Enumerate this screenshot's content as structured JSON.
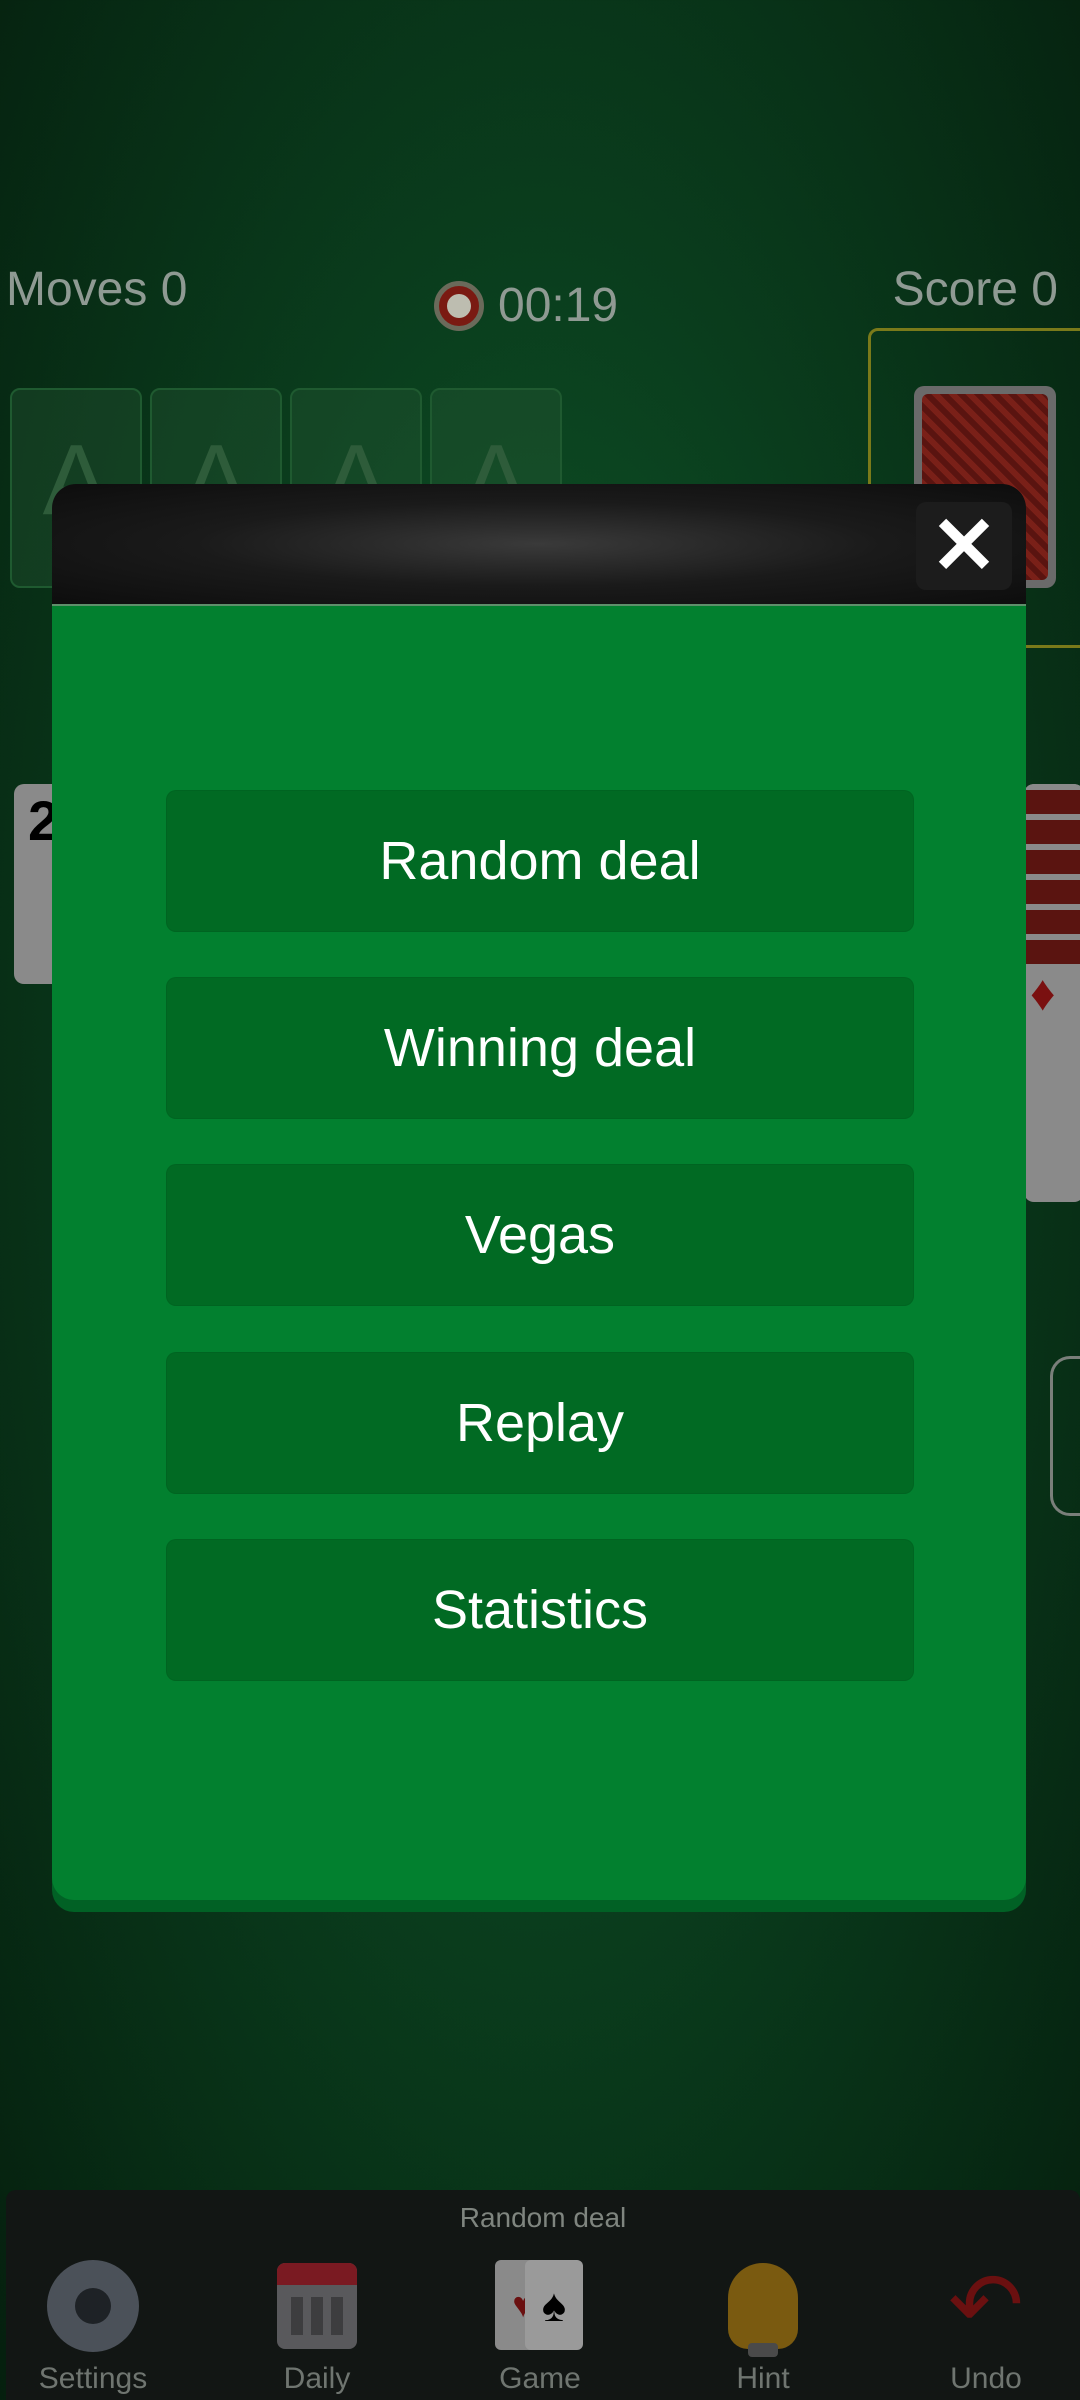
{
  "hud": {
    "moves": "Moves 0",
    "timer": "00:19",
    "score": "Score 0"
  },
  "foundations": [
    "A",
    "A",
    "A",
    "A"
  ],
  "tableau": {
    "left_card_rank": "2",
    "right_suit": "♦"
  },
  "modal": {
    "close_label": "✕",
    "buttons": [
      "Random deal",
      "Winning deal",
      "Vegas",
      "Replay",
      "Statistics"
    ]
  },
  "bottom_bar": {
    "mode": "Random deal",
    "tools": [
      {
        "label": "Settings",
        "icon": "gear-icon"
      },
      {
        "label": "Daily",
        "icon": "calendar-icon"
      },
      {
        "label": "Game",
        "icon": "cards-icon"
      },
      {
        "label": "Hint",
        "icon": "lightbulb-icon"
      },
      {
        "label": "Undo",
        "icon": "undo-arrow-icon"
      }
    ]
  }
}
